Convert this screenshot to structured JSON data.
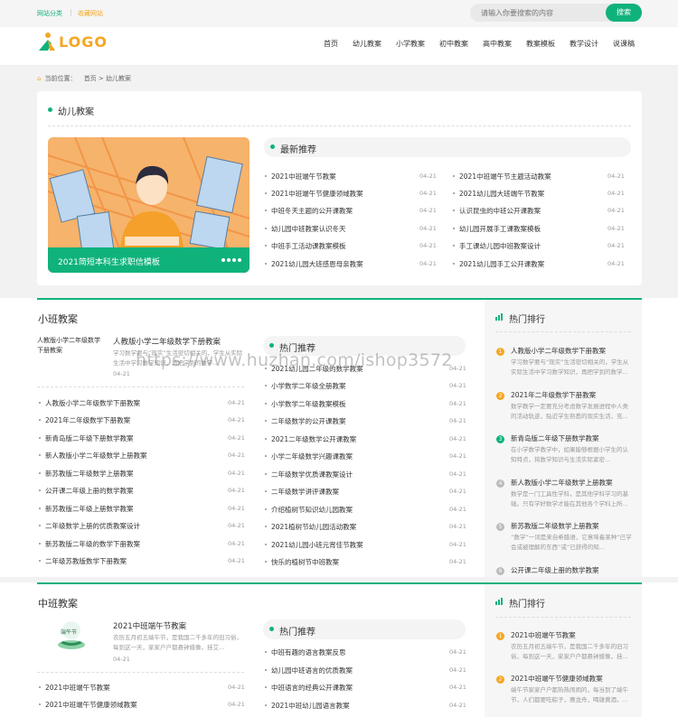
{
  "topbar": {
    "link1": "网站分类",
    "link2": "收藏网站",
    "search_placeholder": "请输入你要搜索的内容",
    "search_button": "搜索"
  },
  "logo": {
    "text": "LOGO"
  },
  "nav": [
    "首页",
    "幼儿教案",
    "小学教案",
    "初中教案",
    "高中教案",
    "教案模板",
    "教学设计",
    "说课稿"
  ],
  "breadcrumb": {
    "label": "当前位置：",
    "home": "首页",
    "sep": ">",
    "current": "幼儿教案"
  },
  "featured": {
    "title": "幼儿教案",
    "hero_caption": "2021简短本科生求职信模板",
    "tab": "最新推荐",
    "left_list": [
      [
        "2021中班端午节教案",
        "04-21"
      ],
      [
        "2021中班端午节健康领域教案",
        "04-21"
      ],
      [
        "中班冬天主题的公开课教案",
        "04-21"
      ],
      [
        "幼儿园中班教案认识冬天",
        "04-21"
      ],
      [
        "中班手工活动课教案模板",
        "04-21"
      ],
      [
        "2021幼儿园大班感恩母亲教案",
        "04-21"
      ]
    ],
    "right_list": [
      [
        "2021中班端午节主题活动教案",
        "04-21"
      ],
      [
        "2021幼儿园大班端午节教案",
        "04-21"
      ],
      [
        "认识昆虫的中班公开课教案",
        "04-21"
      ],
      [
        "幼儿园开展手工课教案模板",
        "04-21"
      ],
      [
        "手工课幼儿园中班教案设计",
        "04-21"
      ],
      [
        "2021幼儿园手工公开课教案",
        "04-21"
      ]
    ]
  },
  "xiaoban": {
    "title": "小班教案",
    "thumb_alt": "人教版小学二年级数学下册教案",
    "article_title": "人教版小学二年级数学下册教案",
    "article_desc": "学习数学要与“现实”生活密切相关的，学生从实际生活中学习数学知识，再把学到的数学...",
    "article_date": "04-21",
    "list": [
      [
        "人教版小学二年级数学下册教案",
        "04-21"
      ],
      [
        "2021年二年级数学下册教案",
        "04-21"
      ],
      [
        "新青岛版二年级下册数学教案",
        "04-21"
      ],
      [
        "新人教版小学二年级数学上册教案",
        "04-21"
      ],
      [
        "新苏教版二年级数学上册教案",
        "04-21"
      ],
      [
        "公开课二年级上册的数学教案",
        "04-21"
      ],
      [
        "新苏教版二年级上册数学教案",
        "04-21"
      ],
      [
        "二年级数学上册的优质教案设计",
        "04-21"
      ],
      [
        "新苏教版二年级的数学下册教案",
        "04-21"
      ],
      [
        "二年级苏教版数学下册教案",
        "04-21"
      ]
    ],
    "tab": "热门推荐",
    "hot": [
      [
        "2021幼儿园二年级的数学教案",
        "04-21"
      ],
      [
        "小学数学二年级全册教案",
        "04-21"
      ],
      [
        "小学数学二年级教案模板",
        "04-21"
      ],
      [
        "二年级数学的公开课教案",
        "04-21"
      ],
      [
        "2021二年级数学公开课教案",
        "04-21"
      ],
      [
        "小学二年级数学兴趣课教案",
        "04-21"
      ],
      [
        "二年级数学优质课教案设计",
        "04-21"
      ],
      [
        "二年级数学讲评课教案",
        "04-21"
      ],
      [
        "介绍植树节知识幼儿园教案",
        "04-21"
      ],
      [
        "2021植树节幼儿园活动教案",
        "04-21"
      ],
      [
        "2021幼儿园小班元宵佳节教案",
        "04-21"
      ],
      [
        "快乐的植树节中班教案",
        "04-21"
      ]
    ],
    "rank_title": "热门排行",
    "rank": [
      {
        "n": "1",
        "t": "人教版小学二年级数学下册教案",
        "d": "学习数学要与“现实”生活密切相关的，学生从实际生活中学习数学知识，再把学到的数学...",
        "c": "#f5a623"
      },
      {
        "n": "2",
        "t": "2021年二年级数学下册教案",
        "d": "数学教学一定要充分考虑数学发展进程中人类的活动轨迹，贴近学生熟悉的现实生活，充...",
        "c": "#f5a623"
      },
      {
        "n": "3",
        "t": "新青岛版二年级下册数学教案",
        "d": "在小学数学教学中，如果能够根据小学生的认知特点，将数学知识与生活实际紧密...",
        "c": "#10b27c"
      },
      {
        "n": "4",
        "t": "新人教版小学二年级数学上册教案",
        "d": "数学是一门工具性学科，是其他学科学习的基础。只有学好数学才能在其他各个学科上所...",
        "c": "#bbb"
      },
      {
        "n": "5",
        "t": "新苏教版二年级数学上册教案",
        "d": "“数学”一词是来自希腊语，它意味着某种“已学会或被理解的东西”或“已获得的知...",
        "c": "#bbb"
      },
      {
        "n": "6",
        "t": "公开课二年级上册的数学教案",
        "d": "",
        "c": "#bbb"
      }
    ]
  },
  "zhongban": {
    "title": "中班教案",
    "thumb_label": "端午节",
    "article_title": "2021中班端午节教案",
    "article_desc": "农历五月初五端午节，是我国二千多年的旧习俗，每到这一天，家家户户都悬钟馗像，挂艾...",
    "article_date": "04-21",
    "list": [
      [
        "2021中班端午节教案",
        "04-21"
      ],
      [
        "2021中班端午节健康领域教案",
        "04-21"
      ]
    ],
    "tab": "热门推荐",
    "hot": [
      [
        "中班有趣的语言教案反思",
        "04-21"
      ],
      [
        "幼儿园中班语言的优质教案",
        "04-21"
      ],
      [
        "中班语言的经典公开课教案",
        "04-21"
      ],
      [
        "2021中班幼儿园语言教案",
        "04-21"
      ]
    ],
    "rank_title": "热门排行",
    "rank": [
      {
        "n": "1",
        "t": "2021中班端午节教案",
        "d": "农历五月初五端午节，是我国二千多年的旧习俗，每到这一天，家家户户都悬钟馗像，挂...",
        "c": "#f5a623"
      },
      {
        "n": "2",
        "t": "2021中班端午节健康领域教案",
        "d": "端午节家家户户都热热闹闹的，每当到了端午节，人们都要吃粽子，赛龙舟，喝雄黄酒，...",
        "c": "#f5a623"
      }
    ]
  },
  "watermark": "https://www.huzhan.com/ishop3572",
  "colors": {
    "accent": "#10b27c",
    "orange": "#f5a623"
  }
}
